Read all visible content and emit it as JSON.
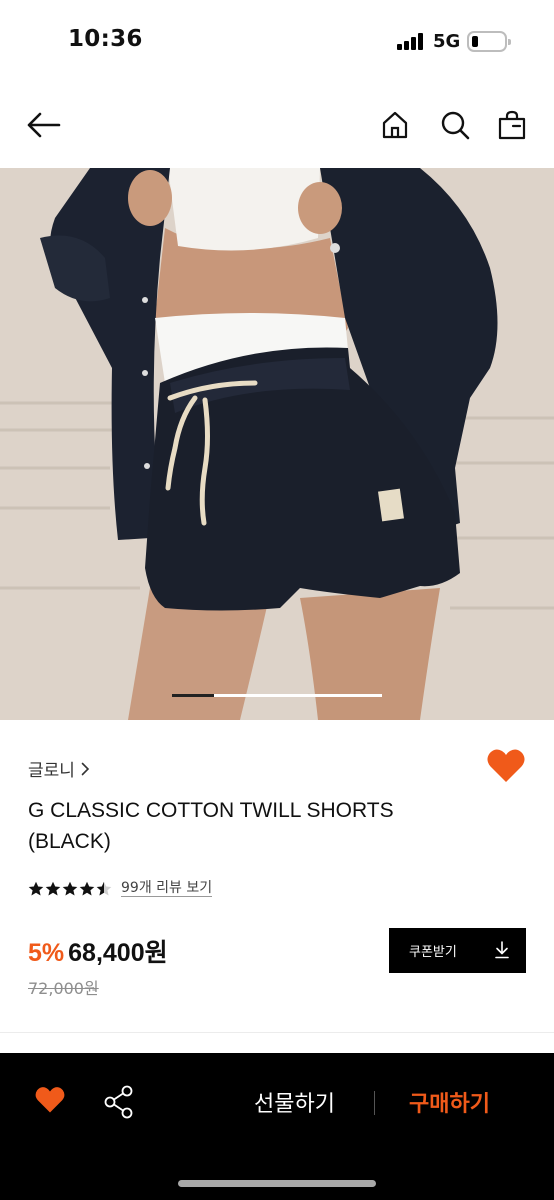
{
  "status_bar": {
    "time": "10:36",
    "network": "5G",
    "battery_level": 0.2
  },
  "nav": {
    "icons": [
      "back-arrow-icon",
      "home-icon",
      "search-icon",
      "shopping-bag-icon"
    ]
  },
  "hero": {
    "image": "product-photo",
    "current_slide_fraction": 0.2
  },
  "product": {
    "brand": "글로니",
    "name_line1": "G CLASSIC COTTON TWILL SHORTS",
    "name_line2": "(BLACK)",
    "rating": 4.5,
    "review_link": "99개 리뷰 보기",
    "discount": "5%",
    "price": "68,400원",
    "original_price": "72,000원",
    "coupon_label": "쿠폰받기"
  },
  "bottom_bar": {
    "gift_label": "선물하기",
    "buy_label": "구매하기"
  },
  "colors": {
    "accent": "#f05a1a",
    "bottom_bar_bg": "#000000",
    "coupon_bg": "#000000"
  }
}
